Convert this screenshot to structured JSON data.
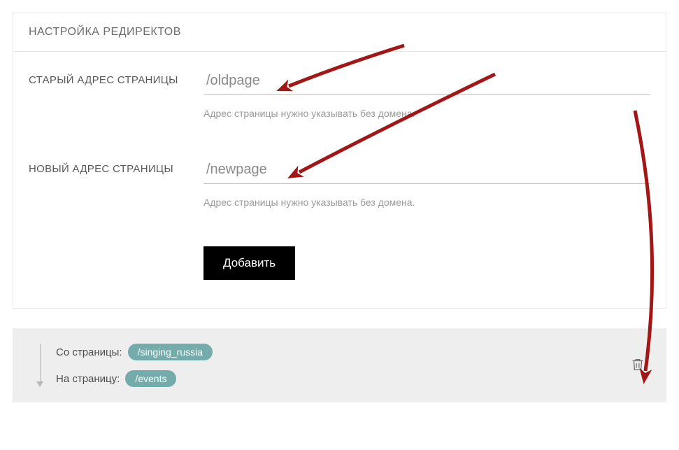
{
  "panel": {
    "title": "НАСТРОЙКА РЕДИРЕКТОВ",
    "fields": {
      "old": {
        "label": "СТАРЫЙ АДРЕС СТРАНИЦЫ",
        "value": "/oldpage",
        "hint": "Адрес страницы нужно указывать без домена."
      },
      "new": {
        "label": "НОВЫЙ АДРЕС СТРАНИЦЫ",
        "value": "/newpage",
        "hint": "Адрес страницы нужно указывать без домена."
      }
    },
    "add_button": "Добавить"
  },
  "redirect_item": {
    "from_label": "Со страницы:",
    "from_value": "/singing_russia",
    "to_label": "На страницу:",
    "to_value": "/events"
  },
  "annotation_color": "#a21616"
}
